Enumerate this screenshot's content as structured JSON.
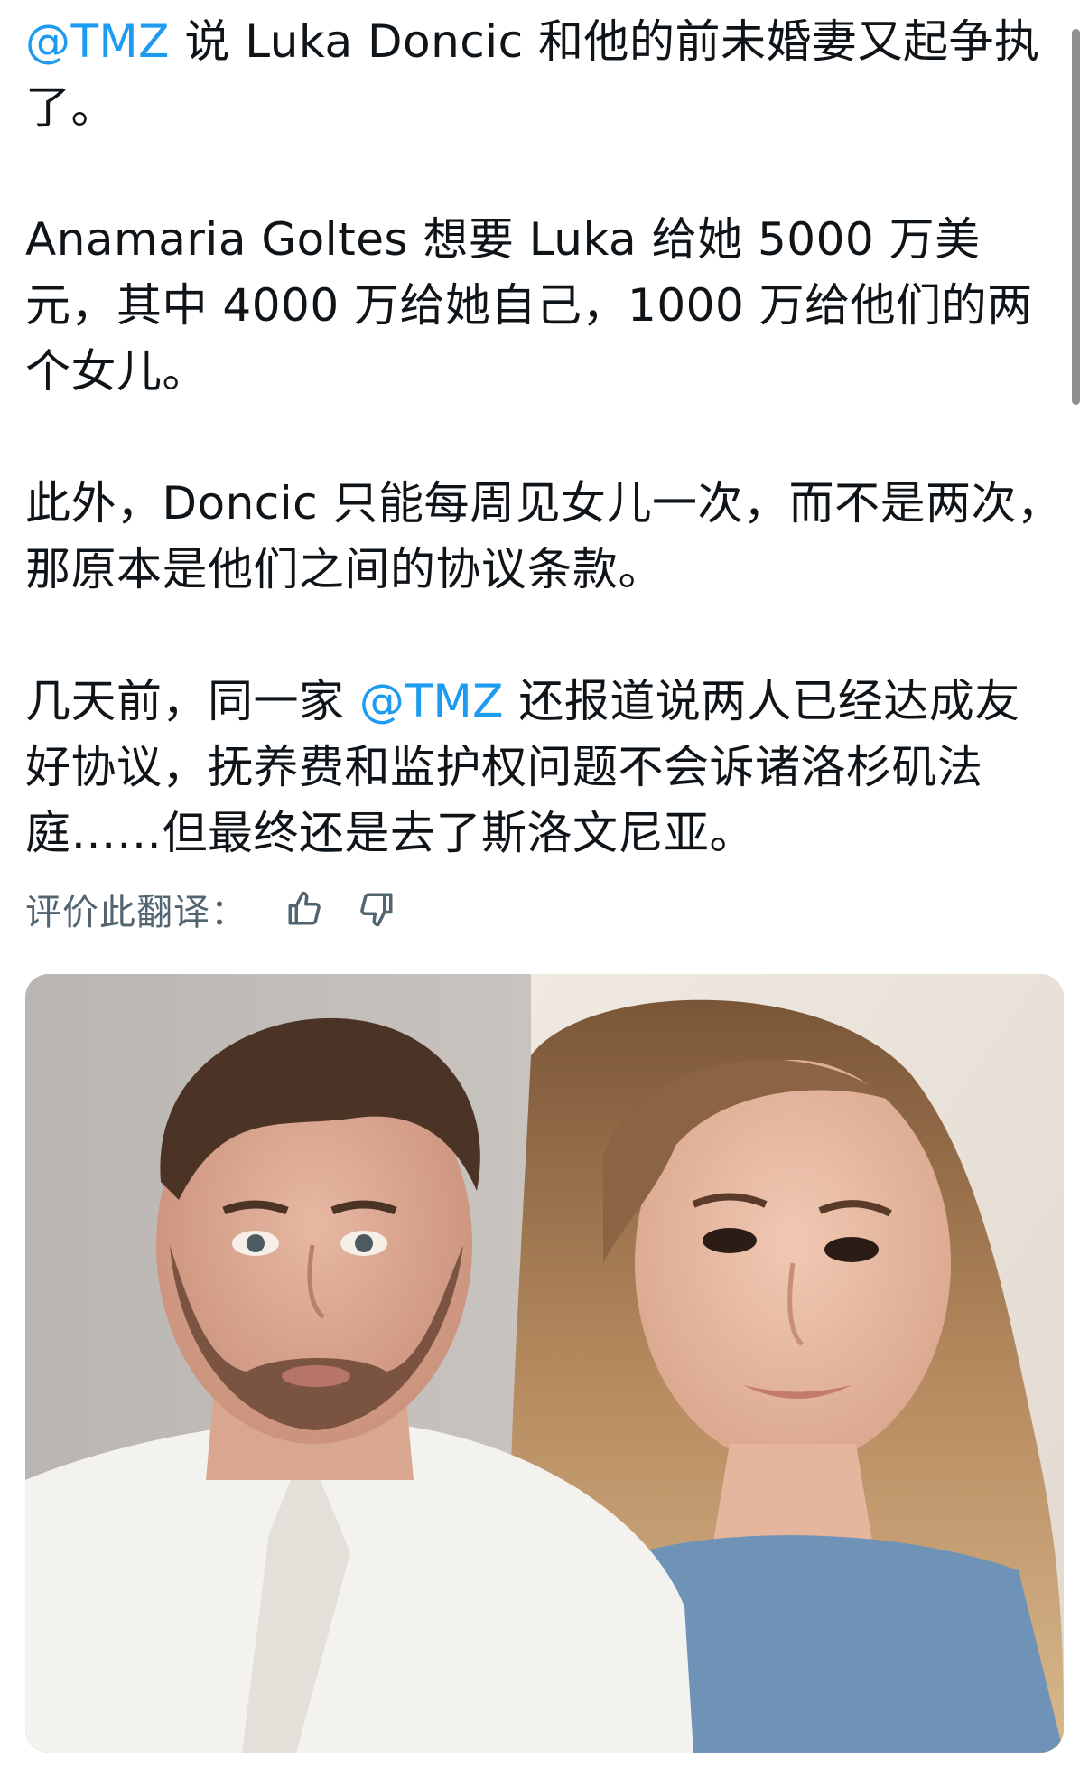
{
  "tweet": {
    "mention_tmz": "@TMZ",
    "p1_text": " 说 Luka Doncic 和他的前未婚妻又起争执了。",
    "p2_text": "Anamaria Goltes 想要 Luka 给她 5000 万美元，其中 4000 万给她自己，1000 万给他们的两个女儿。",
    "p3_text": "此外，Doncic 只能每周见女儿一次，而不是两次，那原本是他们之间的协议条款。",
    "p4_before": "几天前，同一家 ",
    "p4_after": " 还报道说两人已经达成友好协议，抚养费和监护权问题不会诉诸洛杉矶法庭……但最终还是去了斯洛文尼亚。"
  },
  "translation_feedback": {
    "label": "评价此翻译：",
    "thumbs_up_icon": "thumbs-up-icon",
    "thumbs_down_icon": "thumbs-down-icon"
  },
  "media": {
    "type": "photo"
  },
  "colors": {
    "mention": "#1d9bf0",
    "text": "#0f1419",
    "secondary_text": "#536471"
  }
}
